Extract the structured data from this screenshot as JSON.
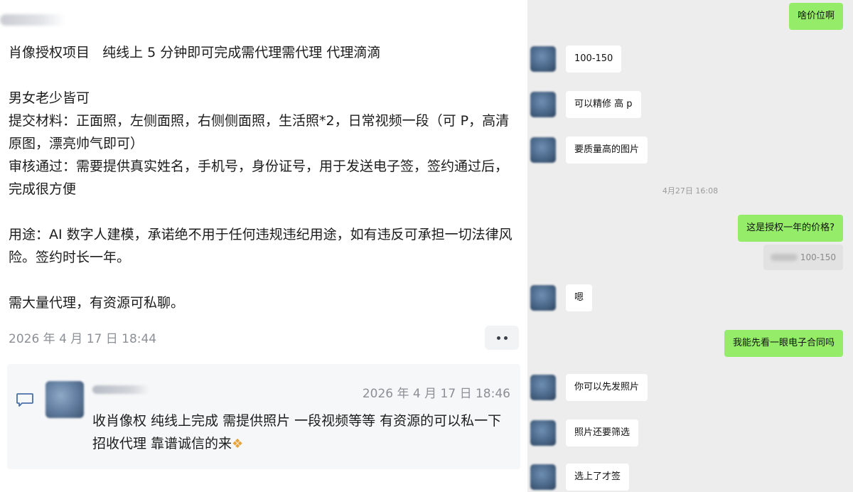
{
  "post": {
    "paragraphs": [
      "肖像授权项目   纯线上 5 分钟即可完成需代理需代理 代理滴滴",
      "",
      "男女老少皆可",
      "提交材料：正面照，左侧面照，右侧侧面照，生活照*2，日常视频一段（可 P，高清原图，漂亮帅气即可）",
      "审核通过：需要提供真实姓名，手机号，身份证号，用于发送电子签，签约通过后，完成很方便",
      "",
      "用途：AI 数字人建模，承诺绝不用于任何违规违纪用途，如有违反可承担一切法律风险。签约时长一年。",
      "",
      "需大量代理，有资源可私聊。"
    ],
    "timestamp": "2026 年 4 月 17 日 18:44"
  },
  "comment": {
    "timestamp": "2026 年 4 月 17 日 18:46",
    "text": "收肖像权 纯线上完成 需提供照片 一段视频等等 有资源的可以私一下 招收代理 靠谱诚信的来",
    "emoji_icon": "handshake-icon"
  },
  "chat": {
    "messages": [
      {
        "side": "out",
        "text": "啥价位啊"
      },
      {
        "side": "in",
        "text": "100-150"
      },
      {
        "side": "in",
        "text": "可以精修 高 p"
      },
      {
        "side": "in",
        "text": "要质量高的图片"
      },
      {
        "side": "out",
        "text": "这是授权一年的价格?"
      },
      {
        "side": "in",
        "text": "嗯"
      },
      {
        "side": "out",
        "text": "我能先看一眼电子合同吗"
      },
      {
        "side": "in",
        "text": "你可以先发照片"
      },
      {
        "side": "in",
        "text": "照片还要筛选"
      },
      {
        "side": "in",
        "text": "选上了才签"
      }
    ],
    "timestamp": "4月27日 16:08",
    "quote_text": "100-150"
  },
  "colors": {
    "out_bubble": "#95ec69",
    "in_bubble": "#ffffff",
    "chat_bg": "#ededed"
  }
}
